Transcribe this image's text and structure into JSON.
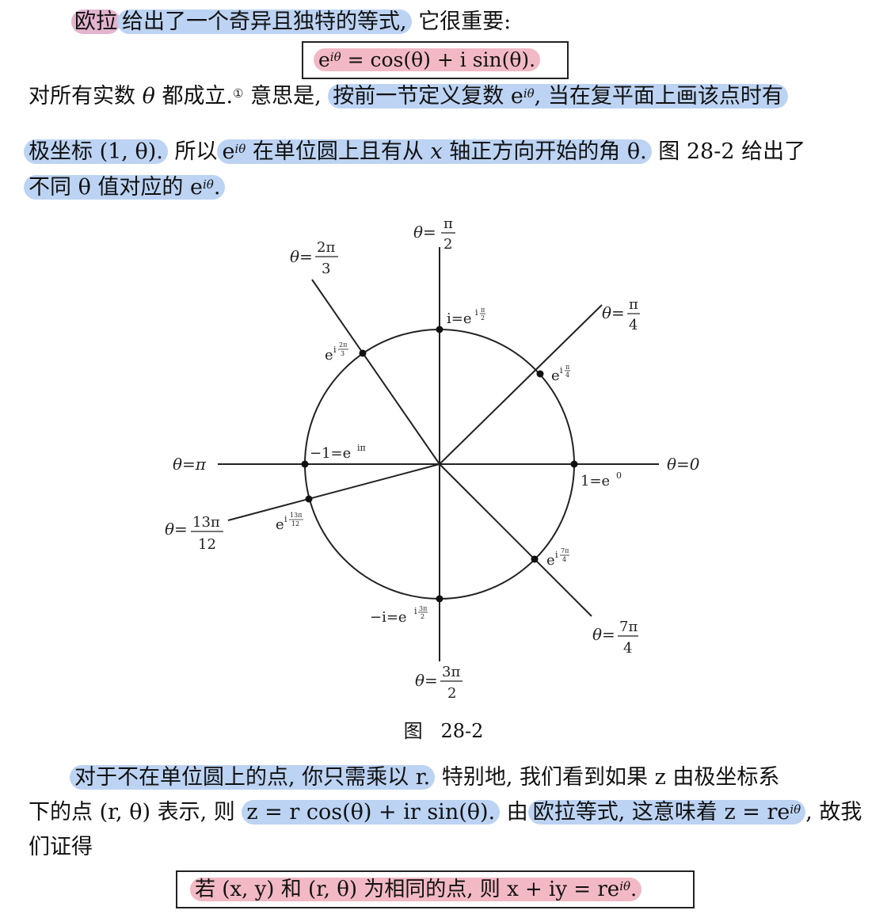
{
  "para1": {
    "euler": "欧拉",
    "rest": "给出了一个奇异且独特的等式,",
    "tail": "它很重要:"
  },
  "formula1": {
    "lhs": "e",
    "lhs_sup": "iθ",
    "rhs": "= cos(θ) + i sin(θ)."
  },
  "para2": {
    "line1_a": "对所有实数",
    "theta": "θ",
    "line1_b": "都成立.",
    "footnote": "①",
    "line1_c": "意思是,",
    "line1_hl": "按前一节定义复数 e",
    "line1_hl_sup": "iθ",
    "line1_hl_b": ", 当在复平面上画该点时有",
    "line2_hl1": "极坐标 (1, θ).",
    "line2_a": "所以",
    "line2_hl2": "e",
    "line2_hl2_sup": "iθ",
    "line2_hl2_b": " 在单位圆上且有从 ",
    "line2_x": "x",
    "line2_hl2_c": " 轴正方向开始的角 θ.",
    "line2_b": "图 28-2 给出了",
    "line3_hl": "不同 θ 值对应的 e",
    "line3_hl_sup": "iθ",
    "line3_tail": "."
  },
  "figure": {
    "caption_a": "图",
    "caption_b": "28-2",
    "labels": {
      "theta_eq": "θ=",
      "pi": "π",
      "two": "2",
      "two_pi": "2π",
      "three": "3",
      "four": "4",
      "seven_pi": "7π",
      "three_pi": "3π",
      "thirteen_pi": "13π",
      "twelve": "12",
      "theta_pi": "θ=π",
      "theta_zero": "θ=0",
      "one_eq": "1=e",
      "one_sup": "0",
      "minus_one_eq": "−1=e",
      "minus_one_sup": "iπ",
      "i_eq": "i=e",
      "minus_i_eq": "−i=e",
      "e": "e",
      "i": "i"
    }
  },
  "para3": {
    "line1_hl": "对于不在单位圆上的点, 你只需乘以 r.",
    "line1_b": "特别地, 我们看到如果 z 由极坐标系",
    "line2_a": "下的点 (r, θ) 表示, 则",
    "line2_hl1": "z = r cos(θ) + ir sin(θ).",
    "line2_b": "由",
    "line2_hl2": "欧拉等式, 这意味着 z = re",
    "line2_hl2_sup": "iθ",
    "line2_c": ", 故我",
    "line3": "们证得"
  },
  "formula2": {
    "text": "若 (x, y) 和 (r, θ) 为相同的点, 则 x + iy = re",
    "sup": "iθ",
    "tail": "."
  }
}
